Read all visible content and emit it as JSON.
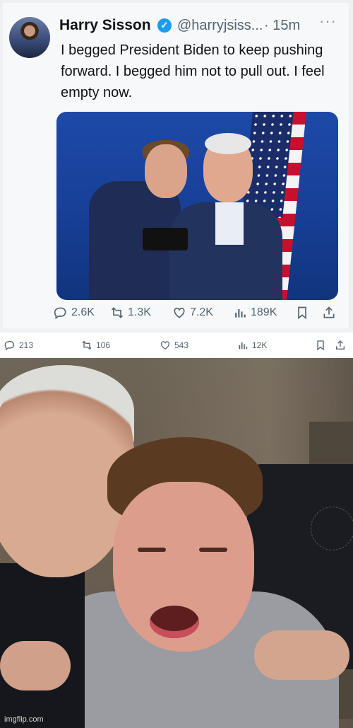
{
  "tweet": {
    "author_name": "Harry Sisson",
    "handle": "@harryjsiss...",
    "time": "· 15m",
    "more": "···",
    "text": "I begged President Biden to keep pushing forward.  I begged him not to pull out.  I feel empty now.",
    "actions": {
      "replies": "2.6K",
      "reposts": "1.3K",
      "likes": "7.2K",
      "views": "189K"
    }
  },
  "meta_row": {
    "replies": "213",
    "reposts": "106",
    "likes": "543",
    "views": "12K"
  },
  "watermark": "imgflip.com",
  "icons": {
    "verified": "verified-badge-icon",
    "reply": "reply-icon",
    "repost": "repost-icon",
    "like": "heart-icon",
    "views": "views-icon",
    "bookmark": "bookmark-icon",
    "share": "share-icon"
  },
  "colors": {
    "verified_blue": "#1d9bf0",
    "secondary_text": "#536471"
  }
}
